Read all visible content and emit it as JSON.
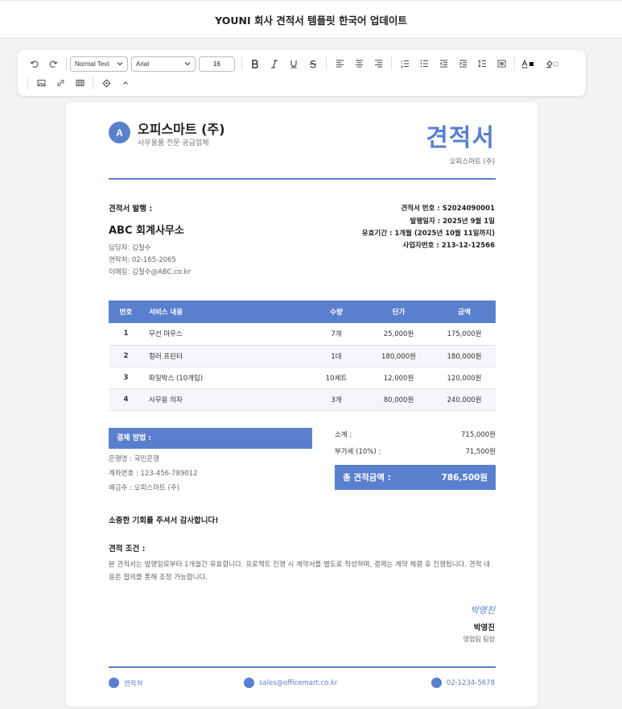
{
  "page_title": "YOUNI 회사 견적서 템플릿 한국어 업데이트",
  "toolbar": {
    "block_format": "Normal Text",
    "font_family": "Arial",
    "font_size": "16"
  },
  "company": {
    "logo_letter": "A",
    "name": "오피스마트 (주)",
    "tagline": "사무용품 전문 공급업체"
  },
  "document": {
    "title": "견적서",
    "issuer": "오피스마트 (주)"
  },
  "client": {
    "heading": "견적서 발행 :",
    "name": "ABC 회계사무소",
    "contact_person": "담당자: 김철수",
    "phone": "연락처: 02-165-2065",
    "email": "이메일: 김철수@ABC.co.kr"
  },
  "meta": {
    "quote_number": "견적서 번호 : S2024090001",
    "issue_date": "발행일자 : 2025년 9월 1일",
    "validity": "유효기간 : 1개월 (2025년 10월 11일까지)",
    "business_number": "사업자번호 : 213-12-12566"
  },
  "table": {
    "headers": [
      "번호",
      "서비스 내용",
      "수량",
      "단가",
      "금액"
    ],
    "rows": [
      [
        "1",
        "무선 마우스",
        "7개",
        "25,000원",
        "175,000원"
      ],
      [
        "2",
        "컬러 프린터",
        "1대",
        "180,000원",
        "180,000원"
      ],
      [
        "3",
        "파일박스 (10개입)",
        "10세트",
        "12,000원",
        "120,000원"
      ],
      [
        "4",
        "사무용 의자",
        "3개",
        "80,000원",
        "240,000원"
      ]
    ]
  },
  "payment": {
    "heading": "결제 방법 :",
    "bank": "은행명 : 국민은행",
    "account": "계좌번호 : 123-456-789012",
    "holder": "예금주 : 오피스마트 (주)"
  },
  "summary": {
    "subtotal_label": "소계 :",
    "subtotal_value": "715,000원",
    "vat_label": "부가세 (10%) :",
    "vat_value": "71,500원",
    "total_label": "총 견적금액 :",
    "total_value": "786,500원"
  },
  "thanks": "소중한 기회를 주셔서 감사합니다!",
  "terms": {
    "heading": "견적 조건 :",
    "text": "본 견적서는 발행일로부터 1개월간 유효합니다. 프로젝트 진행 시 계약서를 별도로 작성하며, 결제는 계약 체결 후 진행됩니다. 견적 내용은 협의를 통해 조정 가능합니다."
  },
  "signature": {
    "script": "박영진",
    "name": "박영진",
    "title": "영업팀 팀장"
  },
  "footer": {
    "contact_label": "연락처",
    "email": "sales@officemart.co.kr",
    "phone": "02-1234-5678"
  },
  "colors": {
    "accent": "#5a7fcf",
    "row_alt": "#f4f6f9"
  }
}
